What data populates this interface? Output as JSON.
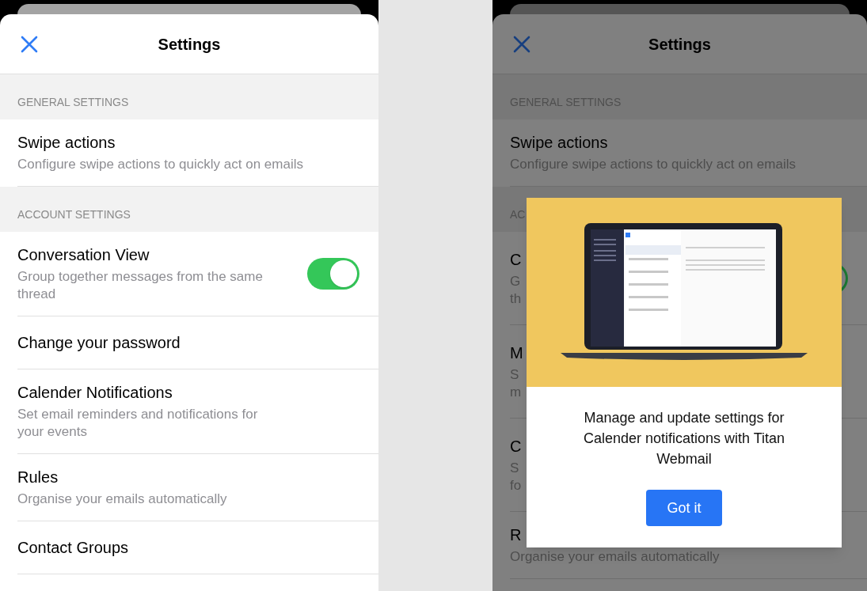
{
  "panels": [
    {
      "title": "Settings",
      "sections": [
        {
          "header": "GENERAL SETTINGS",
          "items": [
            {
              "kind": "plain",
              "title": "Swipe actions",
              "subtitle": "Configure swipe actions to quickly act on emails"
            }
          ]
        },
        {
          "header": "ACCOUNT SETTINGS",
          "items": [
            {
              "kind": "toggle",
              "title": "Conversation View",
              "subtitle": "Group together messages from the same thread",
              "on": true
            },
            {
              "kind": "plain",
              "title": "Change your password"
            },
            {
              "kind": "plain",
              "title": "Calender Notifications",
              "subtitle": "Set email reminders and notifications for your events"
            },
            {
              "kind": "plain",
              "title": "Rules",
              "subtitle": "Organise your emails automatically"
            },
            {
              "kind": "plain",
              "title": "Contact Groups"
            }
          ]
        }
      ]
    },
    {
      "title": "Settings",
      "sections": [
        {
          "header": "GENERAL SETTINGS",
          "items": [
            {
              "kind": "plain",
              "title": "Swipe actions",
              "subtitle": "Configure swipe actions to quickly act on emails"
            }
          ]
        },
        {
          "header": "AC",
          "items": [
            {
              "kind": "toggle",
              "title": "C",
              "subtitle": "G",
              "subtitle2": "th",
              "on": true
            },
            {
              "kind": "plain",
              "title": "M",
              "subtitle": "S",
              "subtitle2": "m"
            },
            {
              "kind": "plain",
              "title": "C",
              "subtitle": "S",
              "subtitle2": "fo"
            },
            {
              "kind": "plain",
              "title": "R",
              "subtitle": "Organise your emails automatically"
            }
          ]
        }
      ],
      "dialog": {
        "message": "Manage and update settings for Calender notifications with Titan Webmail",
        "button": "Got it"
      }
    }
  ]
}
